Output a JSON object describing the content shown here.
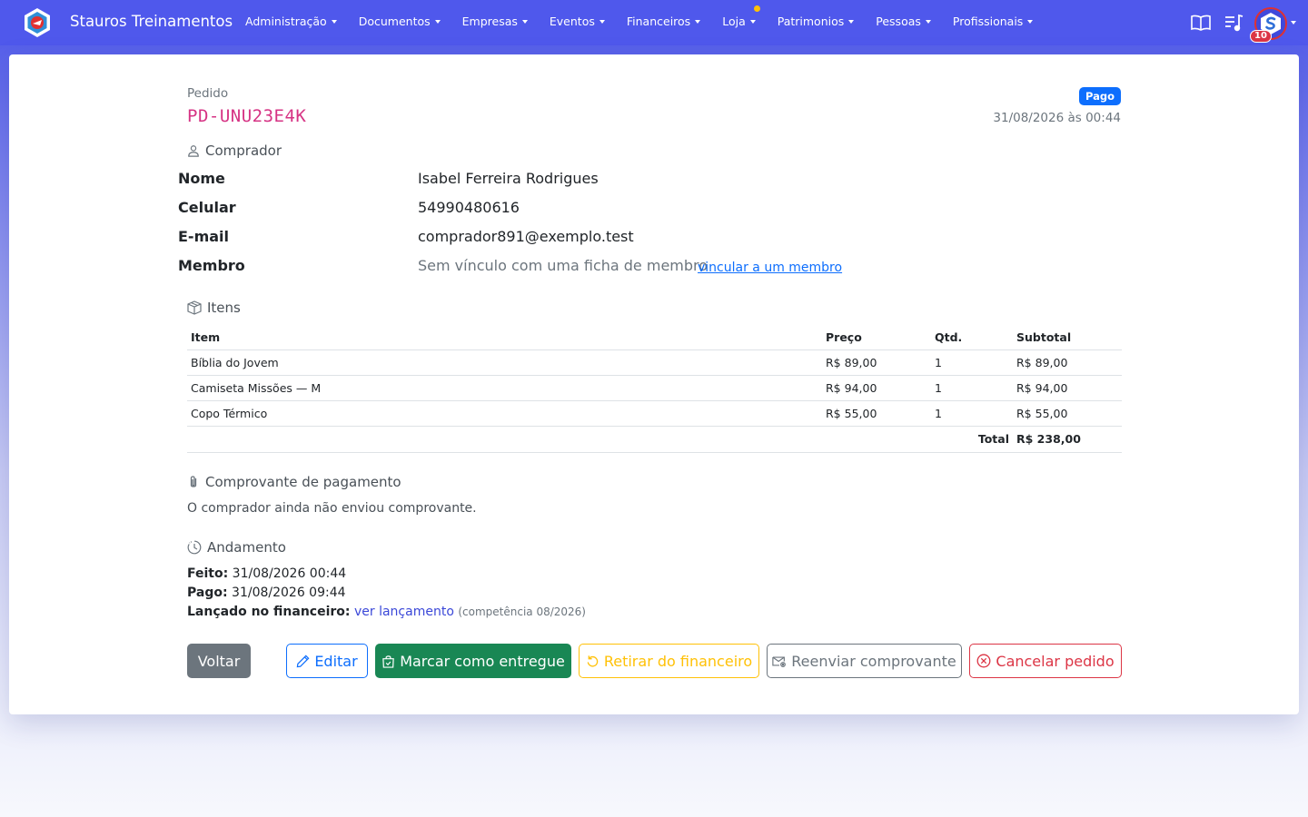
{
  "navbar": {
    "brand": "Stauros Treinamentos",
    "menu": [
      {
        "label": "Administração",
        "dot": false
      },
      {
        "label": "Documentos",
        "dot": false
      },
      {
        "label": "Empresas",
        "dot": false
      },
      {
        "label": "Eventos",
        "dot": false
      },
      {
        "label": "Financeiros",
        "dot": false
      },
      {
        "label": "Loja",
        "dot": true
      },
      {
        "label": "Patrimonios",
        "dot": false
      },
      {
        "label": "Pessoas",
        "dot": false
      },
      {
        "label": "Profissionais",
        "dot": false
      }
    ],
    "icons": [
      "book-icon",
      "playlist-icon"
    ],
    "notification_count": "10"
  },
  "order": {
    "label": "Pedido",
    "code": "PD-UNU23E4K",
    "status": "Pago",
    "datetime": "31/08/2026 às 00:44"
  },
  "buyer": {
    "section_title": "Comprador",
    "name_label": "Nome",
    "name": "Isabel Ferreira Rodrigues",
    "phone_label": "Celular",
    "phone": "54990480616",
    "email_label": "E-mail",
    "email": "comprador891@exemplo.test",
    "member_label": "Membro",
    "member_value": "Sem vínculo com uma ficha de membro",
    "member_link": "vincular a um membro"
  },
  "items": {
    "section_title": "Itens",
    "headers": {
      "item": "Item",
      "price": "Preço",
      "qty": "Qtd.",
      "subtotal": "Subtotal"
    },
    "rows": [
      {
        "item": "Bíblia do Jovem",
        "price": "R$ 89,00",
        "qty": "1",
        "subtotal": "R$ 89,00"
      },
      {
        "item": "Camiseta Missões — M",
        "price": "R$ 94,00",
        "qty": "1",
        "subtotal": "R$ 94,00"
      },
      {
        "item": "Copo Térmico",
        "price": "R$ 55,00",
        "qty": "1",
        "subtotal": "R$ 55,00"
      }
    ],
    "total_label": "Total",
    "total_value": "R$ 238,00"
  },
  "receipt": {
    "section_title": "Comprovante de pagamento",
    "message": "O comprador ainda não enviou comprovante."
  },
  "progress": {
    "section_title": "Andamento",
    "made_label": "Feito:",
    "made_value": "31/08/2026 00:44",
    "paid_label": "Pago:",
    "paid_value": "31/08/2026 09:44",
    "finance_label": "Lançado no financeiro:",
    "finance_link": "ver lançamento",
    "finance_note": "(competência 08/2026)"
  },
  "actions": {
    "back": "Voltar",
    "edit": "Editar",
    "delivered": "Marcar como entregue",
    "remove_finance": "Retirar do financeiro",
    "resend": "Reenviar comprovante",
    "cancel": "Cancelar pedido"
  },
  "colors": {
    "navbar": "#4f58ec",
    "order_code": "#d63384",
    "primary": "#0d6efd",
    "success": "#198754",
    "warning": "#ffc107",
    "danger": "#dc3545",
    "secondary": "#6c757d"
  }
}
